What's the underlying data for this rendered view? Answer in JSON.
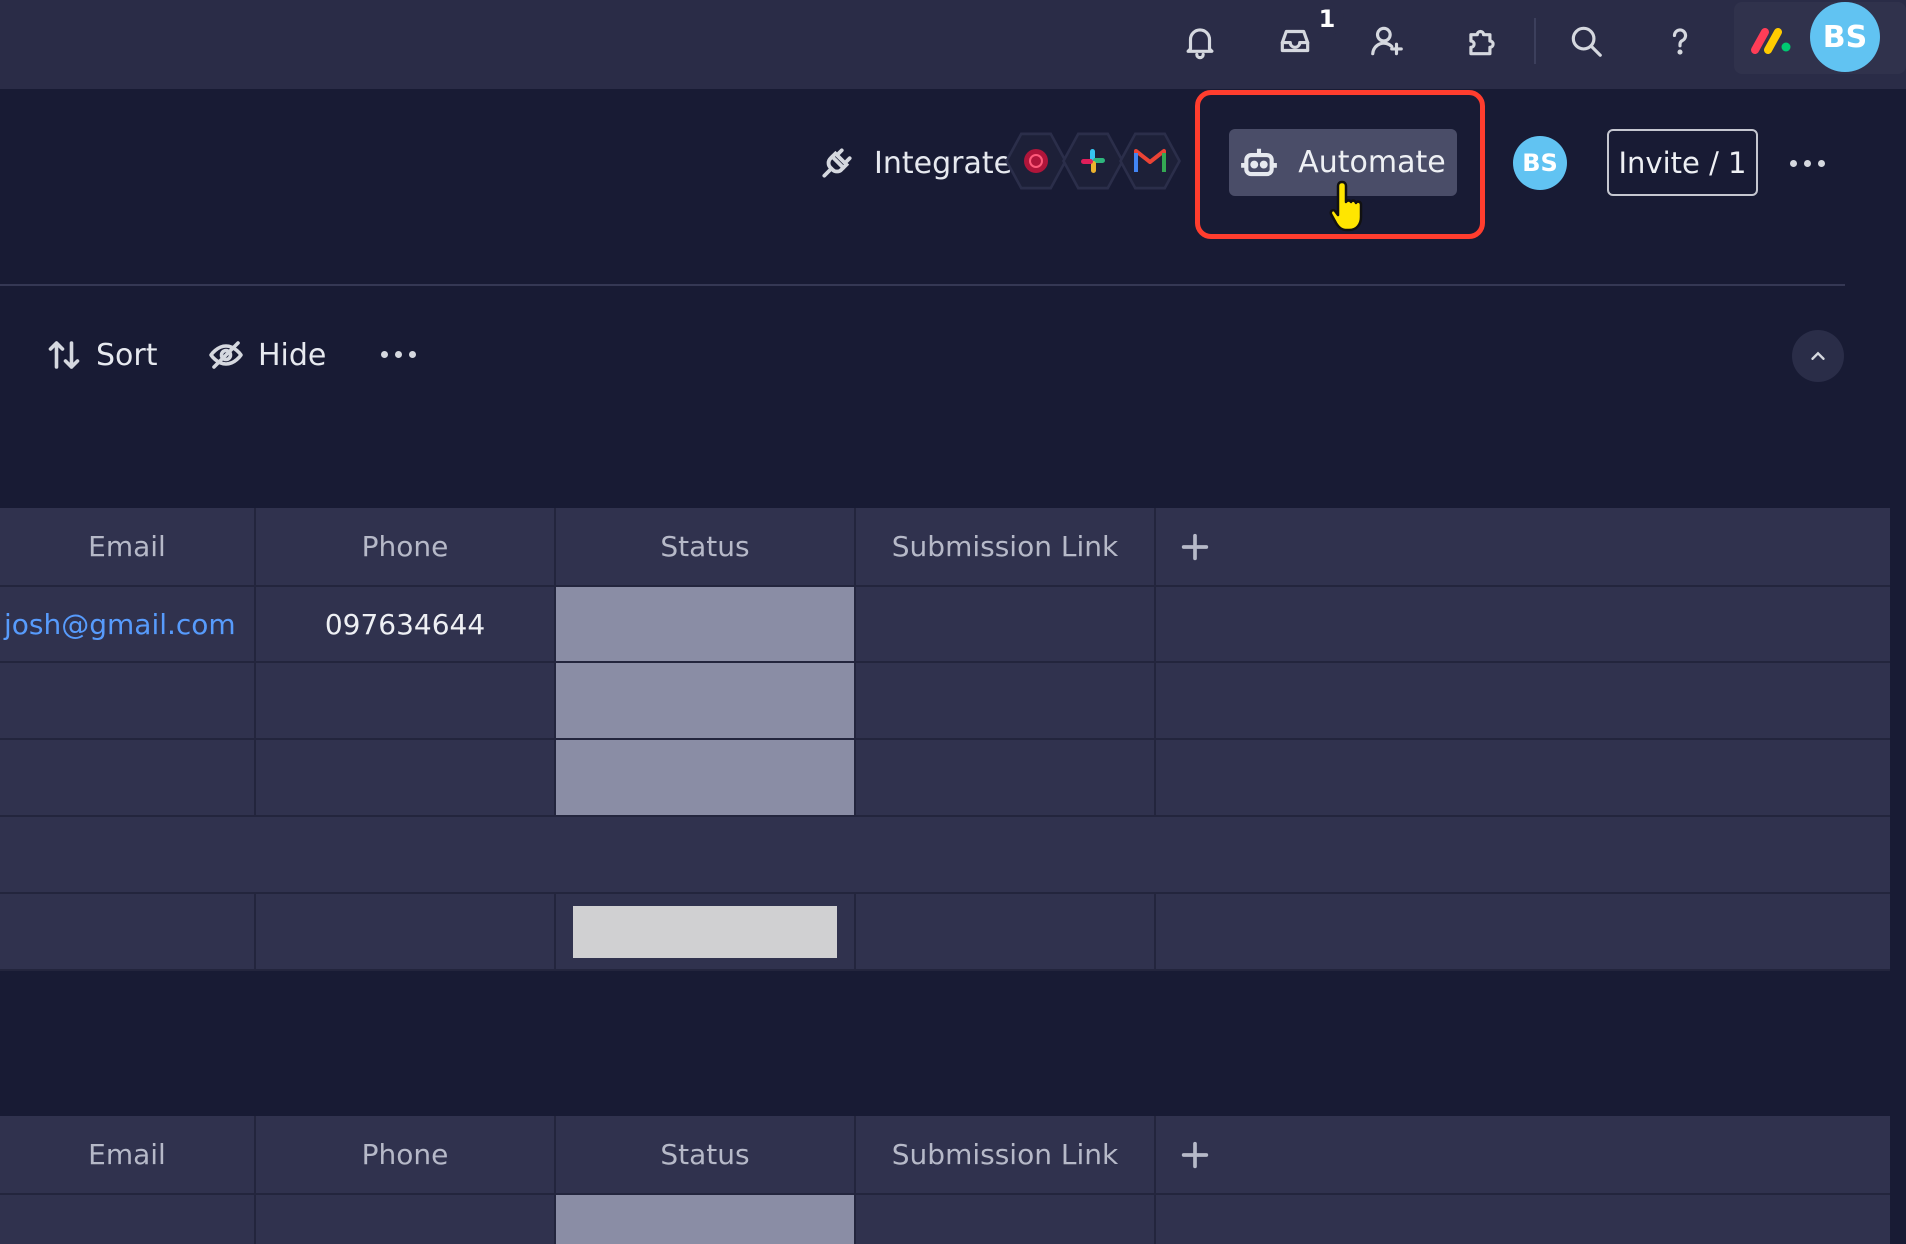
{
  "topbar": {
    "icons": [
      "bell-icon",
      "inbox-icon",
      "invite-members-icon",
      "apps-icon",
      "search-icon",
      "help-icon"
    ],
    "inbox_badge": "1",
    "user_initials": "BS"
  },
  "header": {
    "integrate_label": "Integrate",
    "automate_label": "Automate",
    "member_initials": "BS",
    "invite_label": "Invite / 1"
  },
  "toolbar": {
    "sort_label": "Sort",
    "hide_label": "Hide"
  },
  "table1": {
    "columns": [
      "Email",
      "Phone",
      "Status",
      "Submission Link"
    ],
    "rows": [
      {
        "email": "josh@gmail.com",
        "phone": "097634644"
      }
    ]
  },
  "table2": {
    "columns": [
      "Email",
      "Phone",
      "Status",
      "Submission Link"
    ]
  },
  "colors": {
    "background": "#181b34",
    "accent_highlight": "#ff3d2e",
    "avatar": "#61c3f2",
    "link": "#579bfc"
  }
}
